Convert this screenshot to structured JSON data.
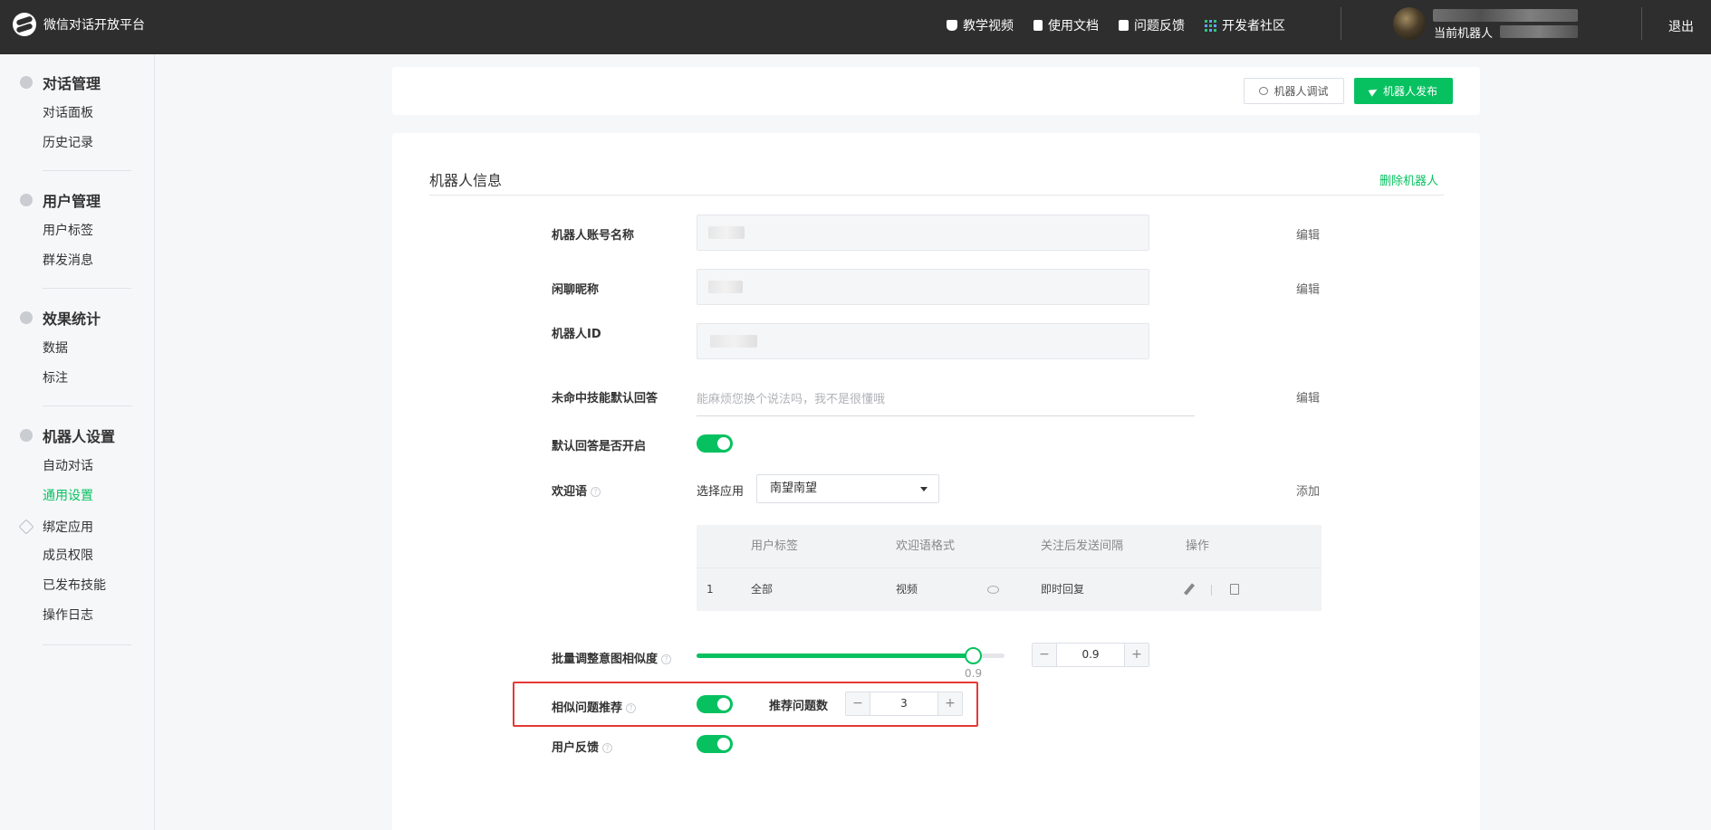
{
  "topbar": {
    "app_title": "微信对话开放平台",
    "nav": [
      {
        "label": "教学视频",
        "icon": "video-icon"
      },
      {
        "label": "使用文档",
        "icon": "doc-icon"
      },
      {
        "label": "问题反馈",
        "icon": "feedback-icon"
      },
      {
        "label": "开发者社区",
        "icon": "community-icon"
      }
    ],
    "user_label": "当前机器人",
    "logout": "退出"
  },
  "sidebar": {
    "groups": [
      {
        "title": "对话管理",
        "icon": "chat-icon",
        "items": [
          "对话面板",
          "历史记录"
        ]
      },
      {
        "title": "用户管理",
        "icon": "user-icon",
        "items": [
          "用户标签",
          "群发消息"
        ]
      },
      {
        "title": "效果统计",
        "icon": "pie-chart-icon",
        "items": [
          "数据",
          "标注"
        ]
      },
      {
        "title": "机器人设置",
        "icon": "gear-icon",
        "items": [
          "自动对话",
          "通用设置"
        ]
      }
    ],
    "bind_app": "绑定应用",
    "extra_items": [
      "成员权限",
      "已发布技能",
      "操作日志"
    ],
    "active_item": "通用设置"
  },
  "toolbar": {
    "debug_label": "机器人调试",
    "publish_label": "机器人发布"
  },
  "robot_info": {
    "section_title": "机器人信息",
    "delete_label": "删除机器人",
    "edit_label": "编辑",
    "add_label": "添加",
    "fields": {
      "account_name": "机器人账号名称",
      "nickname": "闲聊昵称",
      "robot_id": "机器人ID",
      "default_reply": "未命中技能默认回答",
      "default_reply_placeholder": "能麻烦您换个说法吗，我不是很懂哦",
      "default_reply_enabled": "默认回答是否开启",
      "welcome": "欢迎语"
    },
    "welcome": {
      "select_label": "选择应用",
      "selected_app": "南望南望",
      "table_headers": [
        "用户标签",
        "欢迎语格式",
        "关注后发送间隔",
        "操作"
      ],
      "rows": [
        {
          "index": "1",
          "tag": "全部",
          "format": "视频",
          "interval": "即时回复"
        }
      ]
    },
    "similarity": {
      "label": "批量调整意图相似度",
      "value": "0.9",
      "fraction": 0.9,
      "minus": "−",
      "plus": "+"
    },
    "similar_questions": {
      "label": "相似问题推荐",
      "count_label": "推荐问题数",
      "count": "3",
      "minus": "−",
      "plus": "+"
    },
    "user_feedback": {
      "label": "用户反馈"
    },
    "help_glyph": "?"
  },
  "colors": {
    "accent": "#07c160",
    "topbar_bg": "#2e2e2e",
    "highlight_box": "#e53935"
  }
}
